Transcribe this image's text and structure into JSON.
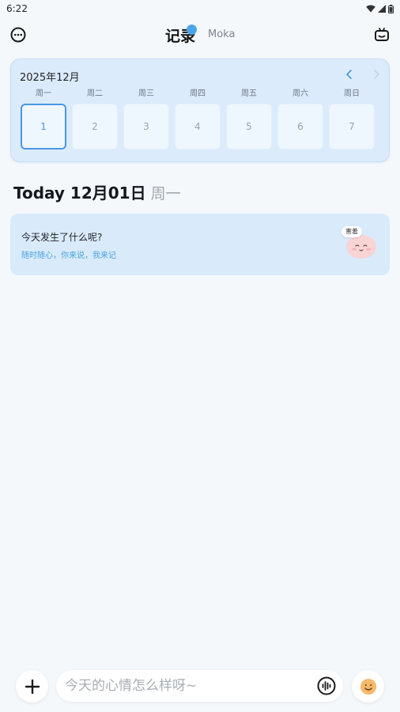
{
  "status_bar": {
    "time": "6:22"
  },
  "header": {
    "title": "记录",
    "user": "Moka"
  },
  "calendar": {
    "month_label": "2025年12月",
    "days": [
      {
        "name": "周一",
        "date": "1",
        "selected": true
      },
      {
        "name": "周二",
        "date": "2",
        "selected": false
      },
      {
        "name": "周三",
        "date": "3",
        "selected": false
      },
      {
        "name": "周四",
        "date": "4",
        "selected": false
      },
      {
        "name": "周五",
        "date": "5",
        "selected": false
      },
      {
        "name": "周六",
        "date": "6",
        "selected": false
      },
      {
        "name": "周日",
        "date": "7",
        "selected": false
      }
    ]
  },
  "date_heading": {
    "main": "Today 12月01日",
    "weekday": "周一"
  },
  "prompt_card": {
    "title": "今天发生了什么呢?",
    "subtitle": "随时随心，你来说，我来记",
    "mascot_tag": "害羞"
  },
  "composer": {
    "placeholder": "今天的心情怎么样呀~"
  },
  "colors": {
    "accent": "#4a97e6",
    "card_bg": "#dcebfb",
    "background": "#f4f8fb"
  },
  "icons": {
    "header_left": "chat-bubble-icon",
    "header_right": "robot-icon",
    "add": "plus-icon",
    "voice": "voice-wave-icon",
    "emoji": "smile-emoji-icon"
  }
}
